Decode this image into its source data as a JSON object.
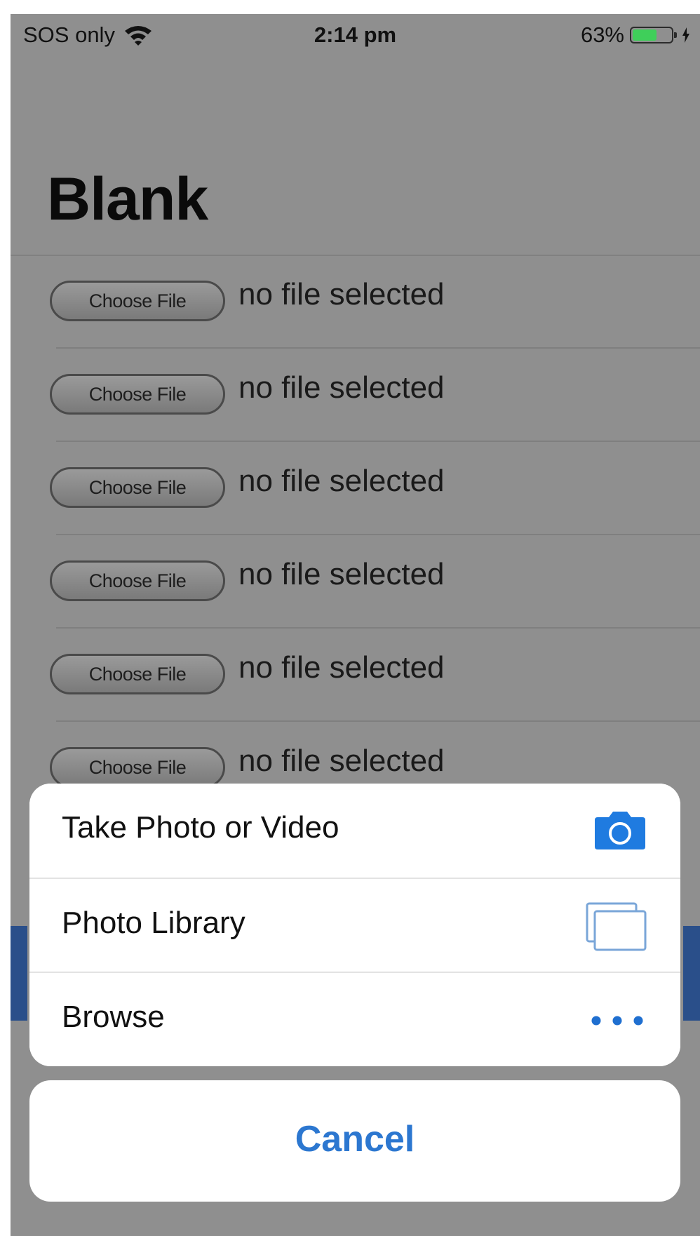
{
  "status_bar": {
    "carrier": "SOS only",
    "time": "2:14 pm",
    "battery_percent": "63%",
    "battery_level": 0.63,
    "battery_color": "#3fcf5a"
  },
  "page": {
    "title": "Blank"
  },
  "file_inputs": [
    {
      "button_label": "Choose File",
      "status": "no file selected"
    },
    {
      "button_label": "Choose File",
      "status": "no file selected"
    },
    {
      "button_label": "Choose File",
      "status": "no file selected"
    },
    {
      "button_label": "Choose File",
      "status": "no file selected"
    },
    {
      "button_label": "Choose File",
      "status": "no file selected"
    },
    {
      "button_label": "Choose File",
      "status": "no file selected"
    }
  ],
  "action_sheet": {
    "options": [
      {
        "label": "Take Photo or Video",
        "icon": "camera-icon"
      },
      {
        "label": "Photo Library",
        "icon": "photo-library-icon"
      },
      {
        "label": "Browse",
        "icon": "more-icon"
      }
    ],
    "cancel_label": "Cancel",
    "accent_color": "#2c77d0"
  }
}
